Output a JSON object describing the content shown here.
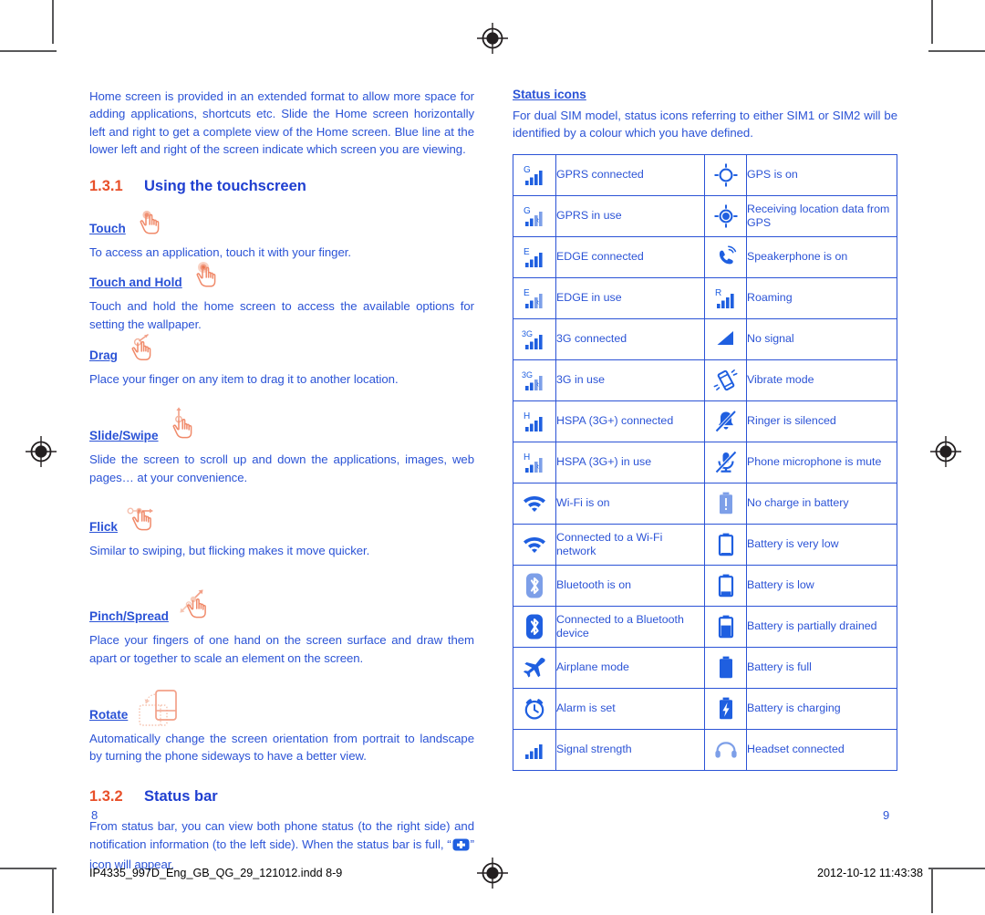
{
  "document": {
    "left_page_number": "8",
    "right_page_number": "9",
    "footer_filename": "IP4335_997D_Eng_GB_QG_29_121012.indd   8-9",
    "footer_timestamp": "2012-10-12   11:43:38"
  },
  "colors": {
    "text_blue": "#2b53d6",
    "heading_blue": "#1f3fd0",
    "section_orange": "#e8502a",
    "gesture_salmon": "#f2a088",
    "icon_blue": "#1f5fe0",
    "icon_light_blue": "#7d9fe8",
    "crop_grey": "#58585a"
  },
  "left_column": {
    "intro_paragraph": "Home screen is provided in an extended format to allow more space for adding applications, shortcuts etc. Slide the Home screen horizontally left and right to get a complete view of the Home screen. Blue line at the lower left and right of the screen indicate which screen you are viewing.",
    "section_1": {
      "number": "1.3.1",
      "title": "Using the touchscreen"
    },
    "gestures": [
      {
        "name": "Touch",
        "icon": "hand-touch-icon",
        "description": "To access an application, touch it with your finger."
      },
      {
        "name": "Touch and Hold",
        "icon": "hand-touch-hold-icon",
        "description": "Touch and hold the home screen to access the available options for setting the wallpaper."
      },
      {
        "name": "Drag",
        "icon": "hand-drag-icon",
        "description": "Place your finger on any item to drag it to another location."
      },
      {
        "name": "Slide/Swipe",
        "icon": "hand-slide-icon",
        "description": "Slide the screen to scroll up and down the applications, images, web pages… at your convenience."
      },
      {
        "name": "Flick",
        "icon": "hand-flick-icon",
        "description": "Similar to swiping, but flicking makes it move quicker."
      },
      {
        "name": "Pinch/Spread",
        "icon": "hand-pinch-spread-icon",
        "description": "Place your fingers of one hand on the screen surface and draw them apart or together to scale an element on the screen."
      },
      {
        "name": "Rotate",
        "icon": "phone-rotate-icon",
        "description": "Automatically change the screen orientation from portrait to landscape by turning the phone sideways to have a better view."
      }
    ],
    "section_2": {
      "number": "1.3.2",
      "title": "Status bar"
    },
    "status_bar_text_before": "From status bar, you can view both phone status (to the right side) and notification information (to the left side). When the status bar is full, “",
    "status_bar_text_after": "”  icon will appear.",
    "status_bar_inline_icon": "plus-badge-icon"
  },
  "right_column": {
    "heading": "Status icons",
    "intro_paragraph": "For dual SIM model, status icons referring to either SIM1 or SIM2 will be identified by a colour which you have defined.",
    "table_rows": [
      {
        "left_icon": "gprs-connected-icon",
        "left_label": "GPRS connected",
        "right_icon": "gps-on-icon",
        "right_label": "GPS is on"
      },
      {
        "left_icon": "gprs-in-use-icon",
        "left_label": "GPRS in use",
        "right_icon": "gps-receiving-icon",
        "right_label": "Receiving location data from GPS"
      },
      {
        "left_icon": "edge-connected-icon",
        "left_label": "EDGE connected",
        "right_icon": "speakerphone-icon",
        "right_label": "Speakerphone is on"
      },
      {
        "left_icon": "edge-in-use-icon",
        "left_label": "EDGE in use",
        "right_icon": "roaming-icon",
        "right_label": "Roaming"
      },
      {
        "left_icon": "3g-connected-icon",
        "left_label": "3G connected",
        "right_icon": "no-signal-icon",
        "right_label": "No signal"
      },
      {
        "left_icon": "3g-in-use-icon",
        "left_label": "3G in use",
        "right_icon": "vibrate-mode-icon",
        "right_label": "Vibrate mode"
      },
      {
        "left_icon": "hspa-connected-icon",
        "left_label": "HSPA (3G+) connected",
        "right_icon": "ringer-silenced-icon",
        "right_label": "Ringer is silenced"
      },
      {
        "left_icon": "hspa-in-use-icon",
        "left_label": "HSPA (3G+) in use",
        "right_icon": "microphone-mute-icon",
        "right_label": "Phone microphone is mute"
      },
      {
        "left_icon": "wifi-on-icon",
        "left_label": "Wi-Fi is on",
        "right_icon": "battery-no-charge-icon",
        "right_label": "No charge in battery"
      },
      {
        "left_icon": "wifi-connected-icon",
        "left_label": "Connected to a Wi-Fi network",
        "right_icon": "battery-very-low-icon",
        "right_label": "Battery is very low"
      },
      {
        "left_icon": "bluetooth-on-icon",
        "left_label": "Bluetooth is on",
        "right_icon": "battery-low-icon",
        "right_label": "Battery is low"
      },
      {
        "left_icon": "bluetooth-connected-icon",
        "left_label": "Connected to a Bluetooth device",
        "right_icon": "battery-partially-drained-icon",
        "right_label": "Battery is partially drained"
      },
      {
        "left_icon": "airplane-mode-icon",
        "left_label": "Airplane mode",
        "right_icon": "battery-full-icon",
        "right_label": "Battery is full"
      },
      {
        "left_icon": "alarm-set-icon",
        "left_label": "Alarm is set",
        "right_icon": "battery-charging-icon",
        "right_label": "Battery is charging"
      },
      {
        "left_icon": "signal-strength-icon",
        "left_label": "Signal strength",
        "right_icon": "headset-connected-icon",
        "right_label": "Headset connected"
      }
    ]
  }
}
